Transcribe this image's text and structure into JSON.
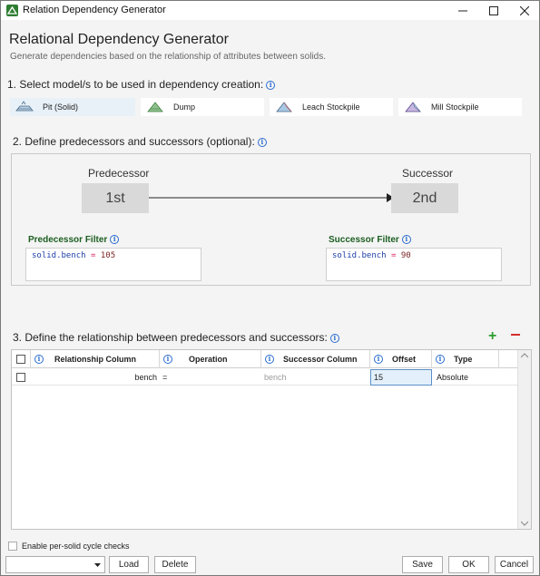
{
  "window": {
    "title": "Relation Dependency Generator"
  },
  "header": {
    "title": "Relational Dependency Generator",
    "subtitle": "Generate dependencies based on the relationship of attributes between solids."
  },
  "section1": {
    "label": "1. Select model/s to be used in dependency creation:",
    "models": [
      {
        "label": "Pit (Solid)",
        "icon": "pit-icon",
        "selected": true
      },
      {
        "label": "Dump",
        "icon": "dump-icon",
        "selected": false
      },
      {
        "label": "Leach Stockpile",
        "icon": "leach-stockpile-icon",
        "selected": false
      },
      {
        "label": "Mill Stockpile",
        "icon": "mill-stockpile-icon",
        "selected": false
      }
    ]
  },
  "section2": {
    "label": "2. Define predecessors and successors (optional):",
    "predecessor_label": "Predecessor",
    "predecessor_node": "1st",
    "successor_label": "Successor",
    "successor_node": "2nd",
    "predecessor_filter": {
      "title": "Predecessor Filter",
      "field": "solid.bench",
      "op": "=",
      "value": "105"
    },
    "successor_filter": {
      "title": "Successor Filter",
      "field": "solid.bench",
      "op": "=",
      "value": "90"
    }
  },
  "section3": {
    "label": "3. Define the relationship between predecessors and successors:",
    "columns": [
      "Relationship Column",
      "Operation",
      "Successor Column",
      "Offset",
      "Type"
    ],
    "rows": [
      {
        "relationship": "bench",
        "operation": "=",
        "successor": "bench",
        "offset": "15",
        "type": "Absolute"
      }
    ]
  },
  "footer": {
    "cycle_check_label": "Enable per-solid cycle checks",
    "load_label": "Load",
    "delete_label": "Delete",
    "save_label": "Save",
    "ok_label": "OK",
    "cancel_label": "Cancel"
  },
  "colors": {
    "accent": "#2e7d32",
    "filter_title": "#1b5e20",
    "info": "#2b6cd0",
    "add": "#2e9d2e",
    "remove": "#d32f2f"
  }
}
